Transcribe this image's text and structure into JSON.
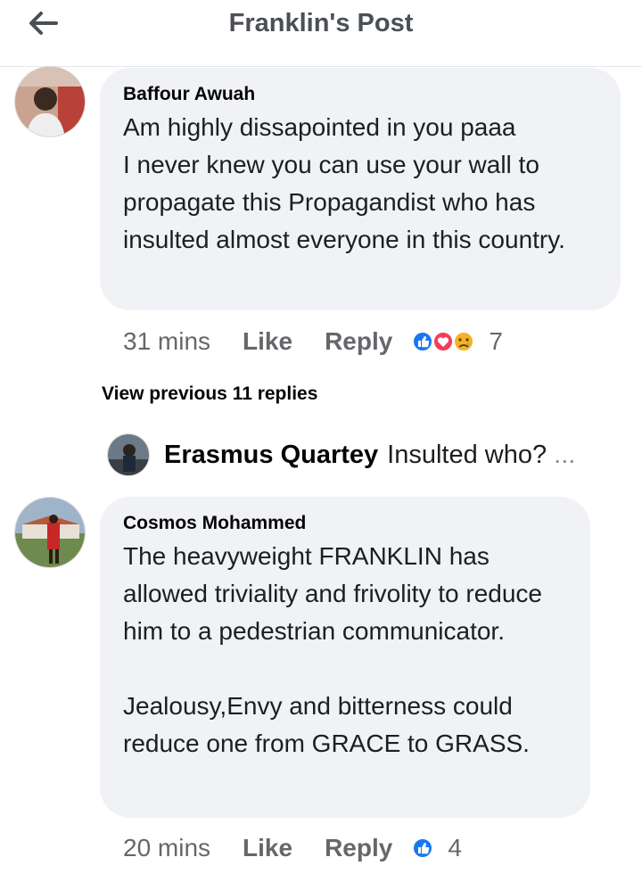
{
  "header": {
    "title": "Franklin's Post"
  },
  "comments": [
    {
      "author": "Baffour Awuah",
      "body": "Am highly dissapointed in you paaa\nI never knew you can use your wall to propagate this Propagandist who has insulted almost everyone in this country.",
      "time": "31 mins",
      "like_label": "Like",
      "reply_label": "Reply",
      "reaction_count": "7",
      "reactions": [
        "like",
        "love",
        "sad"
      ]
    },
    {
      "author": "Cosmos Mohammed",
      "body": "The heavyweight FRANKLIN has allowed triviality and frivolity to reduce him to a pedestrian communicator.\n\nJealousy,Envy and bitterness could reduce one from GRACE to GRASS.",
      "time": "20 mins",
      "like_label": "Like",
      "reply_label": "Reply",
      "reaction_count": "4",
      "reactions": [
        "like"
      ]
    }
  ],
  "view_previous": "View previous 11 replies",
  "reply_preview": {
    "author": "Erasmus Quartey",
    "text": "Insulted who?",
    "ellipsis": "..."
  },
  "colors": {
    "like_blue": "#1877f2",
    "love_red": "#f33e58",
    "sad_yellow": "#f7b125",
    "bubble_bg": "#f0f2f5",
    "meta_gray": "#65676b"
  }
}
